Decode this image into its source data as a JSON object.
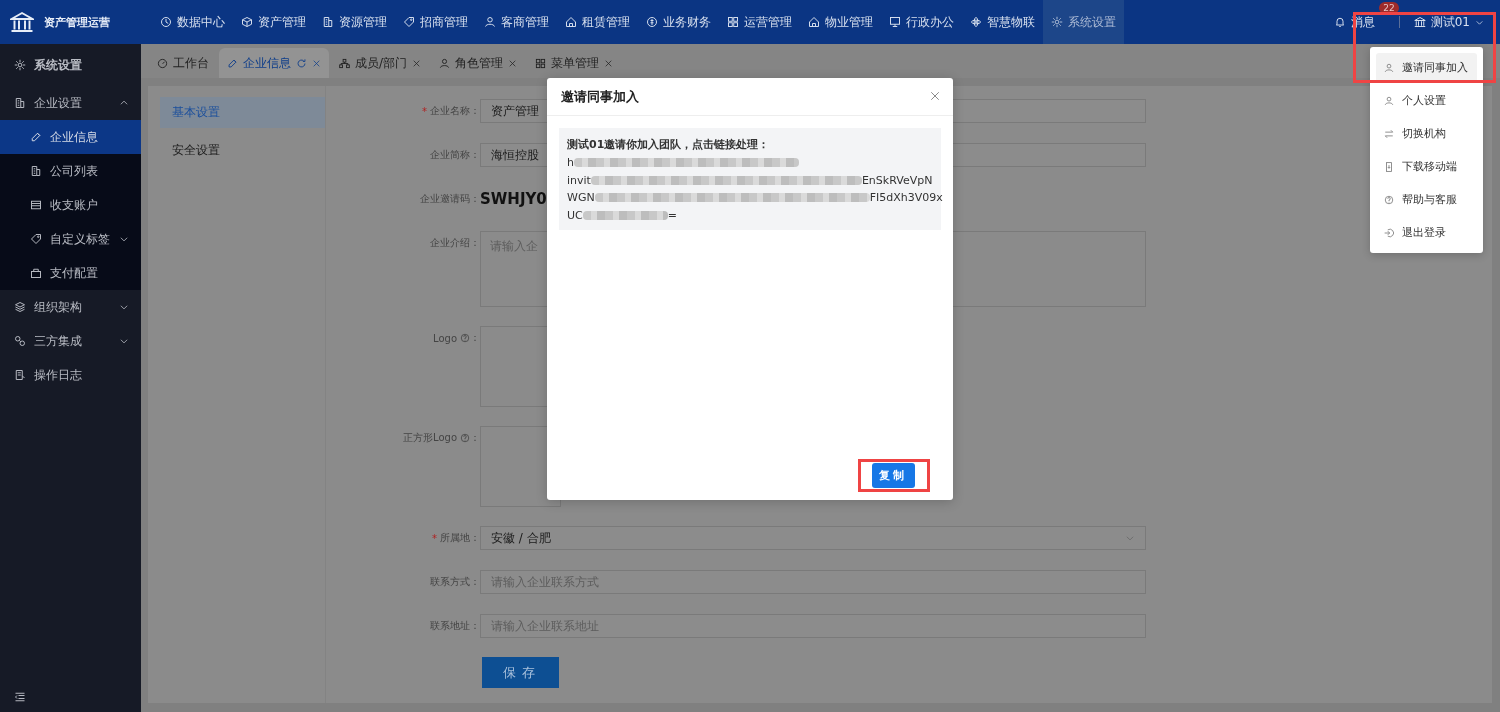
{
  "app": {
    "title": "资产管理运营"
  },
  "top_nav": [
    {
      "label": "数据中心",
      "selected": false
    },
    {
      "label": "资产管理",
      "selected": false
    },
    {
      "label": "资源管理",
      "selected": false
    },
    {
      "label": "招商管理",
      "selected": false
    },
    {
      "label": "客商管理",
      "selected": false
    },
    {
      "label": "租赁管理",
      "selected": false
    },
    {
      "label": "业务财务",
      "selected": false
    },
    {
      "label": "运营管理",
      "selected": false
    },
    {
      "label": "物业管理",
      "selected": false
    },
    {
      "label": "行政办公",
      "selected": false
    },
    {
      "label": "智慧物联",
      "selected": false
    },
    {
      "label": "系统设置",
      "selected": true
    }
  ],
  "messages": {
    "label": "消息",
    "badge": "22"
  },
  "user_menu": {
    "label": "测试01",
    "expanded": true,
    "highlighted": true,
    "items": [
      {
        "label": "邀请同事加入",
        "selected": true
      },
      {
        "label": "个人设置",
        "selected": false
      },
      {
        "label": "切换机构",
        "selected": false
      },
      {
        "label": "下载移动端",
        "selected": false
      },
      {
        "label": "帮助与客服",
        "selected": false
      },
      {
        "label": "退出登录",
        "selected": false
      }
    ]
  },
  "sidebar": {
    "title": "系统设置",
    "items": [
      {
        "label": "企业设置",
        "expanded": true,
        "selected": false,
        "children": [
          {
            "label": "企业信息",
            "selected": true
          },
          {
            "label": "公司列表",
            "selected": false
          },
          {
            "label": "收支账户",
            "selected": false
          },
          {
            "label": "自定义标签",
            "selected": false,
            "expanded": false
          },
          {
            "label": "支付配置",
            "selected": false
          }
        ]
      },
      {
        "label": "组织架构",
        "expanded": false,
        "selected": false
      },
      {
        "label": "三方集成",
        "expanded": false,
        "selected": false
      },
      {
        "label": "操作日志",
        "selected": false
      }
    ]
  },
  "tabs": [
    {
      "label": "工作台",
      "selected": false,
      "closable": false
    },
    {
      "label": "企业信息",
      "selected": true,
      "closable": true
    },
    {
      "label": "成员/部门",
      "selected": false,
      "closable": true
    },
    {
      "label": "角色管理",
      "selected": false,
      "closable": true
    },
    {
      "label": "菜单管理",
      "selected": false,
      "closable": true
    }
  ],
  "settings_menu": [
    {
      "label": "基本设置",
      "selected": true
    },
    {
      "label": "安全设置",
      "selected": false
    }
  ],
  "form": {
    "fields": [
      {
        "kind": "input",
        "required_mark": "*",
        "label": "企业名称",
        "colon": "：",
        "value": "资产管理"
      },
      {
        "kind": "input",
        "label": "企业简称",
        "colon": "：",
        "value": "海恒控股"
      },
      {
        "kind": "code",
        "label": "企业邀请码",
        "colon": "：",
        "value": "SWHJY0"
      },
      {
        "kind": "textarea",
        "label": "企业介绍",
        "colon": "：",
        "placeholder": "请输入企"
      },
      {
        "kind": "upload",
        "label": "Logo",
        "help": true,
        "colon": "："
      },
      {
        "kind": "upload",
        "label": "正方形Logo",
        "help": true,
        "colon": "："
      },
      {
        "kind": "select",
        "required_mark": "*",
        "label": "所属地",
        "colon": "：",
        "value": "安徽 / 合肥"
      },
      {
        "kind": "input",
        "label": "联系方式",
        "colon": "：",
        "placeholder": "请输入企业联系方式"
      },
      {
        "kind": "input",
        "label": "联系地址",
        "colon": "：",
        "placeholder": "请输入企业联系地址"
      }
    ],
    "save_button": "保存"
  },
  "dialog": {
    "title": "邀请同事加入",
    "lines": [
      {
        "start": "测试01邀请你加入团队，点击链接处理：",
        "redacted": false
      },
      {
        "start": "h",
        "redacted": true
      },
      {
        "start": "invit",
        "end": "EnSkRVeVpN",
        "redacted": true
      },
      {
        "start": "WGN",
        "end": "FI5dXh3V09x",
        "redacted": true
      },
      {
        "start": "UC",
        "end": "=",
        "redacted": true
      }
    ],
    "copy_button": {
      "label": "复制",
      "highlighted": true
    }
  }
}
